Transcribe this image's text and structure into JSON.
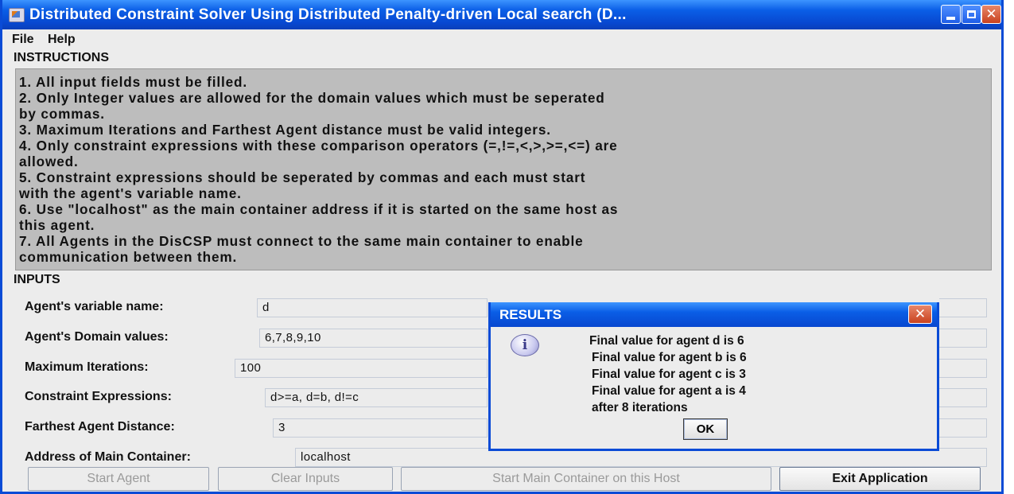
{
  "window": {
    "title": "Distributed Constraint Solver Using Distributed Penalty-driven Local search (D...",
    "close_glyph": "✕"
  },
  "menu": {
    "file": "File",
    "help": "Help"
  },
  "instructions": {
    "heading": "INSTRUCTIONS",
    "lines": [
      "1. All input fields must be filled.",
      "2. Only Integer values are allowed for the domain values which must be seperated",
      "by commas.",
      "3. Maximum Iterations and Farthest Agent distance must be valid integers.",
      "4. Only constraint expressions with these comparison operators (=,!=,<,>,>=,<=) are",
      "allowed.",
      "5. Constraint expressions should be seperated by commas and each must start",
      "with the agent's variable name.",
      "6. Use \"localhost\" as the main container address if it is started on the same host as",
      "this agent.",
      "7. All Agents in the DisCSP must connect to the same main container to enable",
      "communication between them."
    ]
  },
  "inputs": {
    "heading": "INPUTS",
    "variable_name": {
      "label": "Agent's variable name:",
      "value": "d"
    },
    "domain_values": {
      "label": "Agent's Domain values:",
      "value": "6,7,8,9,10"
    },
    "max_iterations": {
      "label": "Maximum Iterations:",
      "value": "100"
    },
    "constraints": {
      "label": "Constraint Expressions:",
      "value": "d>=a, d=b, d!=c"
    },
    "farthest_distance": {
      "label": "Farthest Agent Distance:",
      "value": "3"
    },
    "main_container": {
      "label": "Address of Main Container:",
      "value": "localhost"
    }
  },
  "buttons": {
    "start_agent": "Start Agent",
    "clear_inputs": "Clear Inputs",
    "start_main_container": "Start Main Container on this Host",
    "exit_application": "Exit Application"
  },
  "dialog": {
    "title": "RESULTS",
    "close_glyph": "✕",
    "icon_glyph": "i",
    "lines": [
      "Final value for agent d is 6",
      "Final value for agent b is 6",
      "Final value for agent c is 3",
      "Final value for agent a is 4",
      "after 8 iterations"
    ],
    "ok": "OK"
  }
}
